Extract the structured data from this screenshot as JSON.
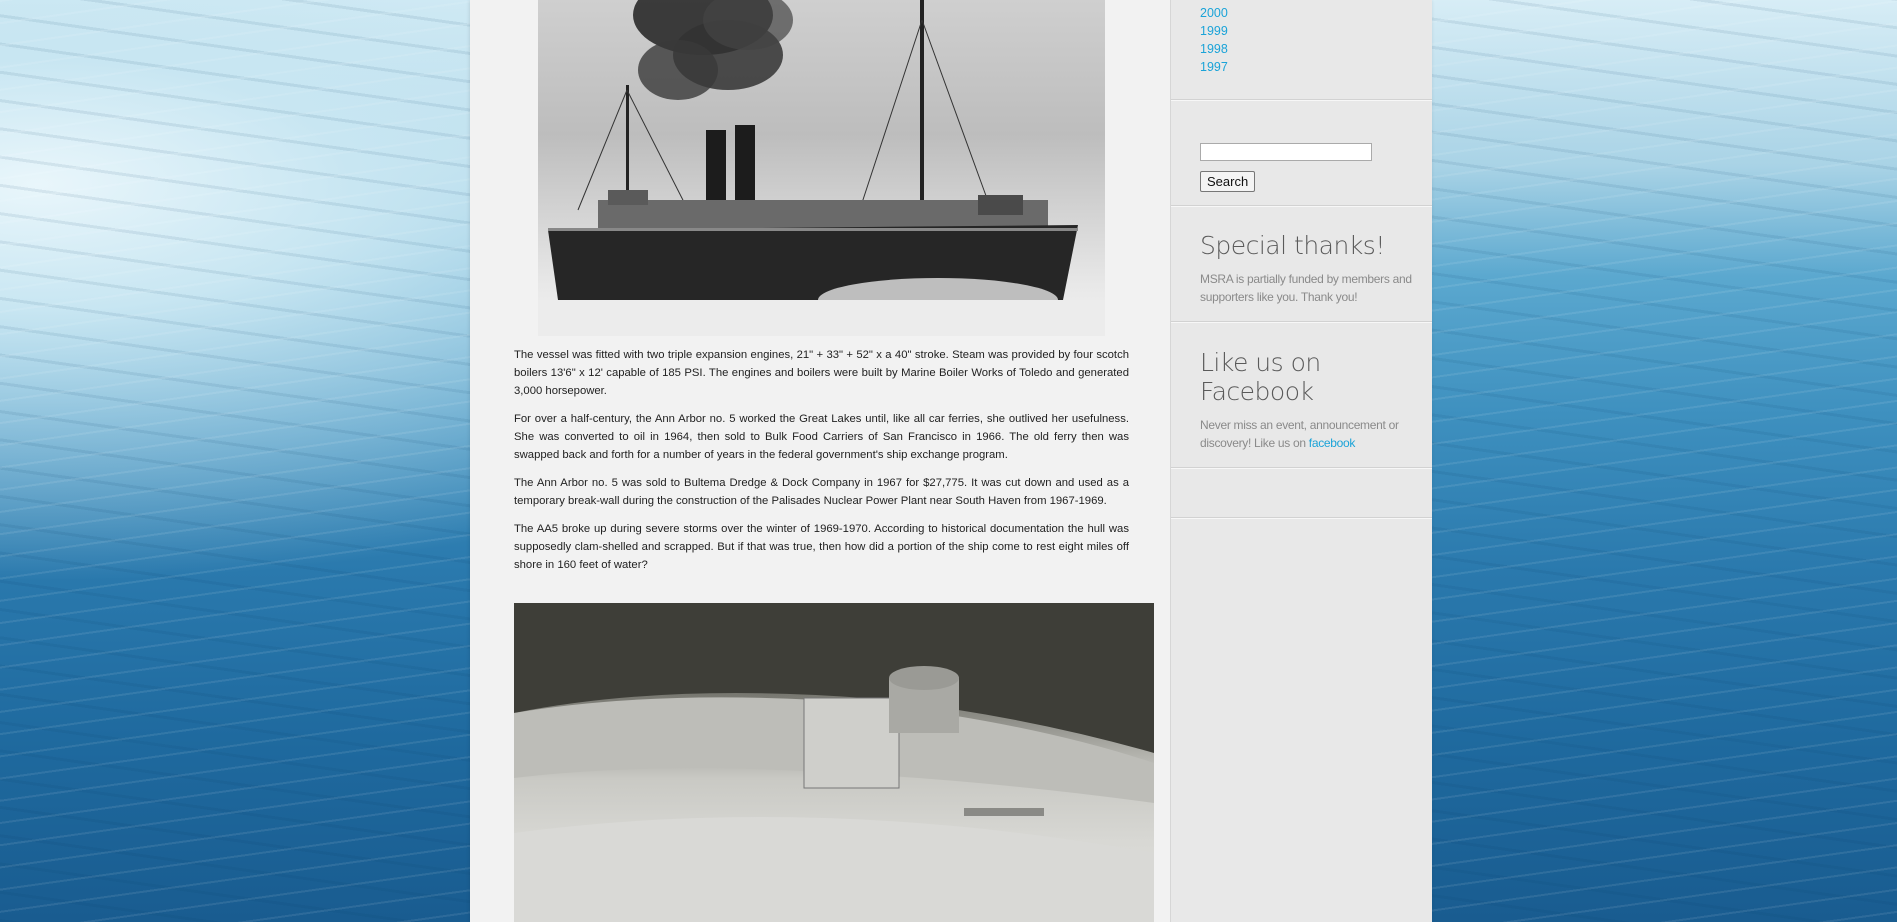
{
  "archive": {
    "years": [
      "2000",
      "1999",
      "1998",
      "1997"
    ]
  },
  "search": {
    "input_value": "",
    "button_label": "Search"
  },
  "thanks": {
    "title": "Special thanks!",
    "text": "MSRA is partially funded by members and supporters like you. Thank you!"
  },
  "facebook": {
    "title": "Like us on Facebook",
    "text_before": "Never miss an event, announcement or discovery! Like us on ",
    "link_text": "facebook"
  },
  "article": {
    "paragraphs": [
      "The vessel was fitted with two triple expansion engines, 21\" + 33\" + 52\" x a 40\" stroke. Steam was provided by four scotch boilers 13'6\" x 12' capable of 185 PSI. The engines and boilers were built by Marine Boiler Works of Toledo and generated 3,000 horsepower.",
      "For over a half-century, the Ann Arbor no. 5 worked the Great Lakes until, like all car ferries, she outlived her usefulness. She was converted to oil in 1964, then sold to Bulk Food Carriers of San Francisco in 1966. The old ferry then was swapped back and forth for a number of years in the federal government's ship exchange program.",
      "The Ann Arbor no. 5 was sold to Bultema Dredge & Dock Company in 1967 for $27,775. It was cut down and used as a temporary break-wall during the construction of the Palisades Nuclear Power Plant near South Haven from 1967-1969.",
      "The AA5 broke up during severe storms over the winter of 1969-1970. According to historical documentation the hull was supposedly clam-shelled and scrapped. But if that was true, then how did a portion of the ship come to rest eight miles off shore in 160 feet of water?"
    ]
  },
  "colors": {
    "link": "#1aa3d8",
    "sidebar_bg": "#e8e8e8",
    "content_bg": "#f2f2f2"
  }
}
